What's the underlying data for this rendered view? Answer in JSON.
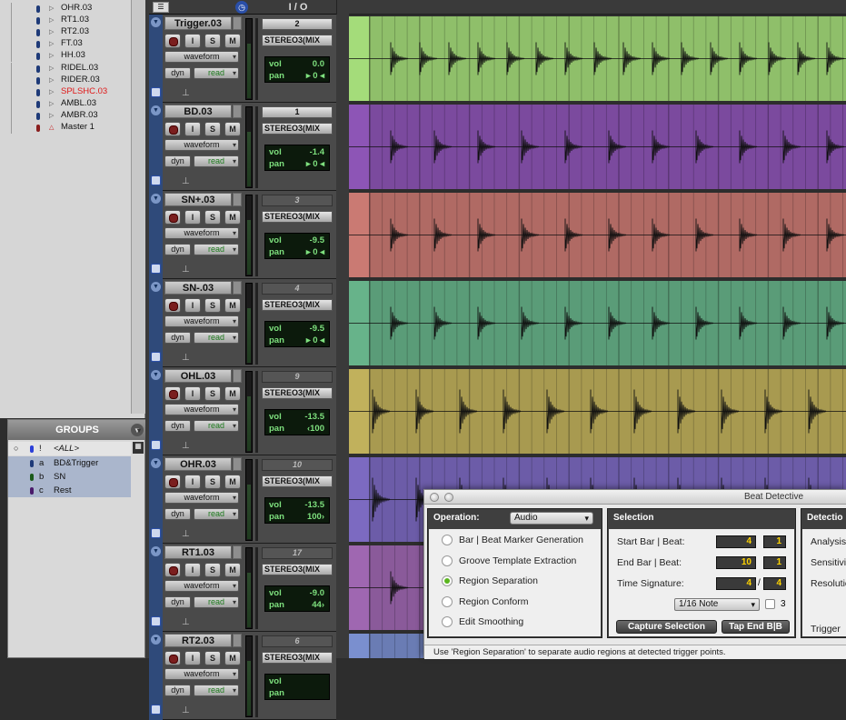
{
  "tracklist": [
    {
      "name": "OHR.03",
      "color": "#111111"
    },
    {
      "name": "RT1.03",
      "color": "#111111"
    },
    {
      "name": "RT2.03",
      "color": "#111111"
    },
    {
      "name": "FT.03",
      "color": "#111111"
    },
    {
      "name": "HH.03",
      "color": "#111111"
    },
    {
      "name": "RIDEL.03",
      "color": "#111111"
    },
    {
      "name": "RIDER.03",
      "color": "#111111"
    },
    {
      "name": "SPLSHC.03",
      "color": "#e01818"
    },
    {
      "name": "AMBL.03",
      "color": "#111111"
    },
    {
      "name": "AMBR.03",
      "color": "#111111"
    },
    {
      "name": "Master 1",
      "color": "#111111"
    }
  ],
  "groups": {
    "title": "GROUPS",
    "all": {
      "key": "!",
      "name": "<ALL>"
    },
    "items": [
      {
        "key": "a",
        "name": "BD&Trigger",
        "color": "#1e3a78"
      },
      {
        "key": "b",
        "name": "SN",
        "color": "#1a5a1a"
      },
      {
        "key": "c",
        "name": "Rest",
        "color": "#4a1a6a"
      }
    ]
  },
  "header": {
    "io_title": "I / O"
  },
  "tracks": [
    {
      "name": "Trigger.03",
      "input": "2",
      "input_active": true,
      "output": "STEREO3(MIX",
      "view": "waveform",
      "automation": "read",
      "dyn": "dyn",
      "vol_label": "vol",
      "vol": "0.0",
      "pan_label": "pan",
      "pan": "▸ 0 ◂",
      "color": "#8fbf6a"
    },
    {
      "name": "BD.03",
      "input": "1",
      "input_active": true,
      "output": "STEREO3(MIX",
      "view": "waveform",
      "automation": "read",
      "dyn": "dyn",
      "vol_label": "vol",
      "vol": "-1.4",
      "pan_label": "pan",
      "pan": "▸ 0 ◂",
      "color": "#7b4a9e"
    },
    {
      "name": "SN+.03",
      "input": "3",
      "input_active": false,
      "output": "STEREO3(MIX",
      "view": "waveform",
      "automation": "read",
      "dyn": "dyn",
      "vol_label": "vol",
      "vol": "-9.5",
      "pan_label": "pan",
      "pan": "▸ 0 ◂",
      "color": "#b06a64"
    },
    {
      "name": "SN-.03",
      "input": "4",
      "input_active": false,
      "output": "STEREO3(MIX",
      "view": "waveform",
      "automation": "read",
      "dyn": "dyn",
      "vol_label": "vol",
      "vol": "-9.5",
      "pan_label": "pan",
      "pan": "▸ 0 ◂",
      "color": "#5a9c78"
    },
    {
      "name": "OHL.03",
      "input": "9",
      "input_active": false,
      "output": "STEREO3(MIX",
      "view": "waveform",
      "automation": "read",
      "dyn": "dyn",
      "vol_label": "vol",
      "vol": "-13.5",
      "pan_label": "pan",
      "pan": "‹100",
      "color": "#a89a50"
    },
    {
      "name": "OHR.03",
      "input": "10",
      "input_active": false,
      "output": "STEREO3(MIX",
      "view": "waveform",
      "automation": "read",
      "dyn": "dyn",
      "vol_label": "vol",
      "vol": "-13.5",
      "pan_label": "pan",
      "pan": "100›",
      "color": "#6c5ca8"
    },
    {
      "name": "RT1.03",
      "input": "17",
      "input_active": false,
      "output": "STEREO3(MIX",
      "view": "waveform",
      "automation": "read",
      "dyn": "dyn",
      "vol_label": "vol",
      "vol": "-9.0",
      "pan_label": "pan",
      "pan": "44›",
      "color": "#8a5a9a"
    },
    {
      "name": "RT2.03",
      "input": "6",
      "input_active": false,
      "output": "STEREO3(MIX",
      "view": "waveform",
      "automation": "read",
      "dyn": "dyn",
      "vol_label": "vol",
      "vol": "",
      "pan_label": "pan",
      "pan": "",
      "color": "#6a7cb4"
    }
  ],
  "beat_detective": {
    "title": "Beat Detective",
    "operation_label": "Operation:",
    "operation_value": "Audio",
    "operations": [
      {
        "label": "Bar | Beat Marker Generation",
        "selected": false
      },
      {
        "label": "Groove Template Extraction",
        "selected": false
      },
      {
        "label": "Region Separation",
        "selected": true
      },
      {
        "label": "Region Conform",
        "selected": false
      },
      {
        "label": "Edit Smoothing",
        "selected": false
      }
    ],
    "selection_title": "Selection",
    "start_label": "Start Bar | Beat:",
    "start_bar": "4",
    "start_beat": "1",
    "end_label": "End Bar | Beat:",
    "end_bar": "10",
    "end_beat": "1",
    "timesig_label": "Time Signature:",
    "timesig_num": "4",
    "timesig_sep": "/",
    "timesig_den": "4",
    "note_value": "1/16 Note",
    "triplet_label": "3",
    "capture_button": "Capture Selection",
    "tap_button": "Tap End B|B",
    "detection_title": "Detectio",
    "detection_analysis": "Analysis",
    "detection_sensitivity": "Sensitivi",
    "detection_resolution": "Resolutio",
    "detection_trigger": "Trigger",
    "status": "Use 'Region Separation' to separate audio regions at detected trigger points."
  }
}
